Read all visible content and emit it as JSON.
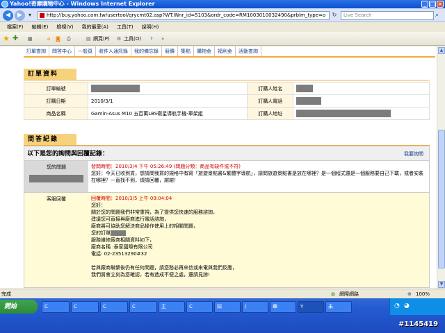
{
  "window": {
    "title": "Yahoo!奇摩購物中心 - Windows Internet Explorer"
  },
  "address": {
    "url": "http://buy.yahoo.com.tw/usertool/qrycmt02.asp?WT.INnr_id=5103&ordr_code=RM1003010032490&prblm_type=o",
    "search_placeholder": "Live Search"
  },
  "menu": [
    "檔案(F)",
    "編輯(E)",
    "檢視(V)",
    "我的最愛(A)",
    "工具(T)",
    "說明(H)"
  ],
  "toolbar": {
    "page_label": "網頁(P)",
    "tools_label": "工具(O)"
  },
  "tabs": [
    "訂單查詢",
    "問答中心",
    "一般頁",
    "收件人通訊錄",
    "我的備忘錄",
    "競價",
    "集點",
    "購物金",
    "福利金",
    "活動查詢"
  ],
  "order": {
    "section_title": "訂單資料",
    "rows": [
      {
        "label": "訂單編號",
        "value": "",
        "label2": "訂購人姓名",
        "value2": ""
      },
      {
        "label": "訂購日期",
        "value": "2010/3/1",
        "label2": "訂購人電話",
        "value2": ""
      },
      {
        "label": "商品名稱",
        "value": "Gamin-Asus M10 五百萬LBS衛星導航手機-車架組",
        "label2": "訂購人地址",
        "value2": ""
      }
    ]
  },
  "qa": {
    "section_title": "問答紀錄",
    "header": "以下是您的詢問與回覆記錄：",
    "ask_link": "我要詢問",
    "question": {
      "who": "您的問題",
      "time": "發問時間：2010/3/4 下午 05:26:49 (問題分類：商品有缺件或不符)",
      "text": "您好：今天已收到貨，想請問我買的規格中有寫「旅遊景點書&繁體字導航」，請問旅遊景點書是放在哪裡？是一個程式還是一個服務要自己下載，或者安裝在哪裡？一直找不到，煩請回覆，謝謝！"
    },
    "answer": {
      "who": "客服回覆",
      "time": "回覆時間：2010/3/5 上午 09:04:04",
      "lines": [
        "您好：",
        "關於您的問題我們非常重視，為了提供您快速的服務諮詢，",
        "建議您可直接與廠商進行電話諮詢，",
        "廠商將可協助您解決商品操作使用上的相關問題，",
        "您的訂單",
        "服務維修廠商相關資料如下，",
        "廠商名稱 :泰家國際有限公司",
        "電話: 02-23513290#32",
        "",
        "若與廠商聯繫後仍有任何問題，請您務必再來信或來電與我們反應，",
        "我們將會立刻為您確認，若有造成不便之處，還請見諒!"
      ]
    }
  },
  "status": {
    "left": "完成",
    "zone": "網際網路",
    "zoom": "100%"
  },
  "taskbar": {
    "start": "開始",
    "buttons": [
      "C",
      "C",
      "C",
      "C",
      "主",
      "C",
      "知",
      "(",
      "華",
      "Y",
      "未"
    ],
    "watermark": "#1145419"
  }
}
